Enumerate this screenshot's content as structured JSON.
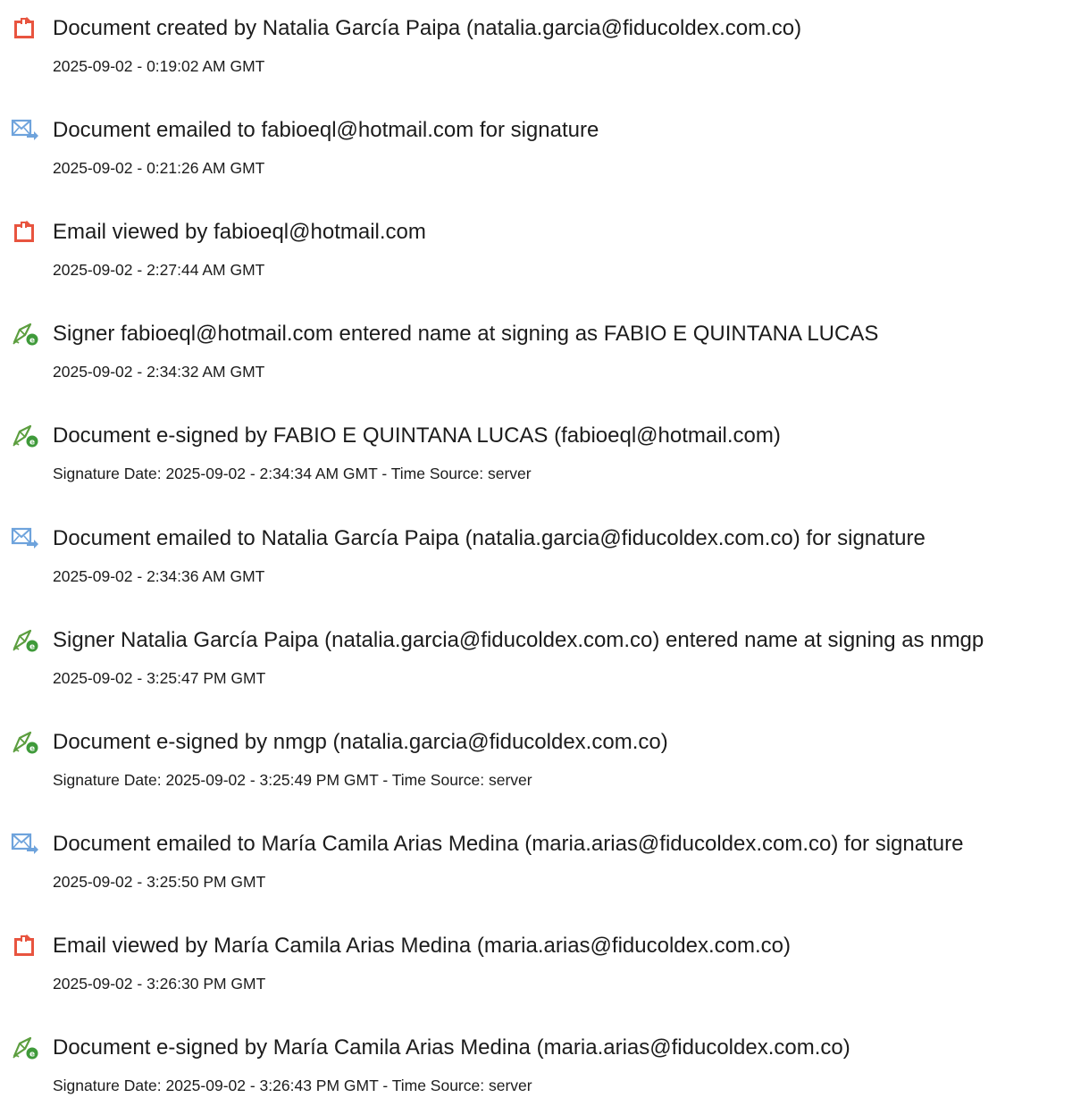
{
  "events": [
    {
      "icon": "document-created-icon",
      "title": "Document created by Natalia García Paipa (natalia.garcia@fiducoldex.com.co)",
      "time": "2025-09-02 - 0:19:02 AM GMT"
    },
    {
      "icon": "email-sent-icon",
      "title": "Document emailed to fabioeql@hotmail.com for signature",
      "time": "2025-09-02 - 0:21:26 AM GMT"
    },
    {
      "icon": "document-viewed-icon",
      "title": "Email viewed by fabioeql@hotmail.com",
      "time": "2025-09-02 - 2:27:44 AM GMT"
    },
    {
      "icon": "esign-pen-icon",
      "title": "Signer fabioeql@hotmail.com entered name at signing as FABIO E QUINTANA LUCAS",
      "time": "2025-09-02 - 2:34:32 AM GMT"
    },
    {
      "icon": "esign-pen-icon",
      "title": "Document e-signed by FABIO E QUINTANA LUCAS (fabioeql@hotmail.com)",
      "time": "Signature Date: 2025-09-02 - 2:34:34 AM GMT - Time Source: server"
    },
    {
      "icon": "email-sent-icon",
      "title": "Document emailed to Natalia García Paipa (natalia.garcia@fiducoldex.com.co) for signature",
      "time": "2025-09-02 - 2:34:36 AM GMT"
    },
    {
      "icon": "esign-pen-icon",
      "title": "Signer Natalia García Paipa (natalia.garcia@fiducoldex.com.co) entered name at signing as nmgp",
      "time": "2025-09-02 - 3:25:47 PM GMT"
    },
    {
      "icon": "esign-pen-icon",
      "title": "Document e-signed by nmgp (natalia.garcia@fiducoldex.com.co)",
      "time": "Signature Date: 2025-09-02 - 3:25:49 PM GMT - Time Source: server"
    },
    {
      "icon": "email-sent-icon",
      "title": "Document emailed to María Camila Arias Medina (maria.arias@fiducoldex.com.co) for signature",
      "time": "2025-09-02 - 3:25:50 PM GMT"
    },
    {
      "icon": "document-viewed-icon",
      "title": "Email viewed by María Camila Arias Medina (maria.arias@fiducoldex.com.co)",
      "time": "2025-09-02 - 3:26:30 PM GMT"
    },
    {
      "icon": "esign-pen-icon",
      "title": "Document e-signed by María Camila Arias Medina (maria.arias@fiducoldex.com.co)",
      "time": "Signature Date: 2025-09-02 - 3:26:43 PM GMT - Time Source: server"
    }
  ],
  "colors": {
    "pdf_icon": "#e8543f",
    "email_icon": "#6ea3dc",
    "pen_icon": "#5c9e3f",
    "text": "#1c1c1c"
  }
}
